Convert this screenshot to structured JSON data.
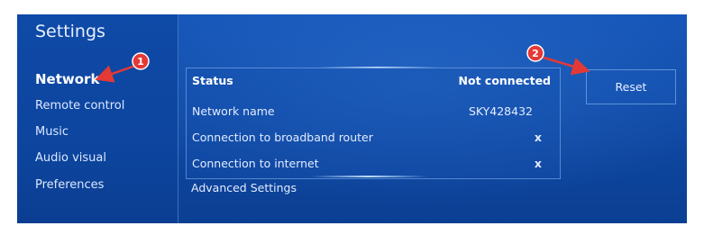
{
  "title": "Settings",
  "menu": [
    {
      "label": "Network",
      "active": true
    },
    {
      "label": "Remote control",
      "active": false
    },
    {
      "label": "Music",
      "active": false
    },
    {
      "label": "Audio visual",
      "active": false
    },
    {
      "label": "Preferences",
      "active": false
    }
  ],
  "network_panel": {
    "header": {
      "label": "Status",
      "value": "Not connected"
    },
    "rows": [
      {
        "label": "Network name",
        "value": "SKY428432"
      },
      {
        "label": "Connection to broadband router",
        "value": "x"
      },
      {
        "label": "Connection to internet",
        "value": "x"
      }
    ]
  },
  "advanced_settings": "Advanced Settings",
  "reset_button": "Reset",
  "annotations": [
    {
      "number": "1"
    },
    {
      "number": "2"
    }
  ],
  "colors": {
    "background": "#0f4aa6",
    "annotation": "#e53935"
  }
}
